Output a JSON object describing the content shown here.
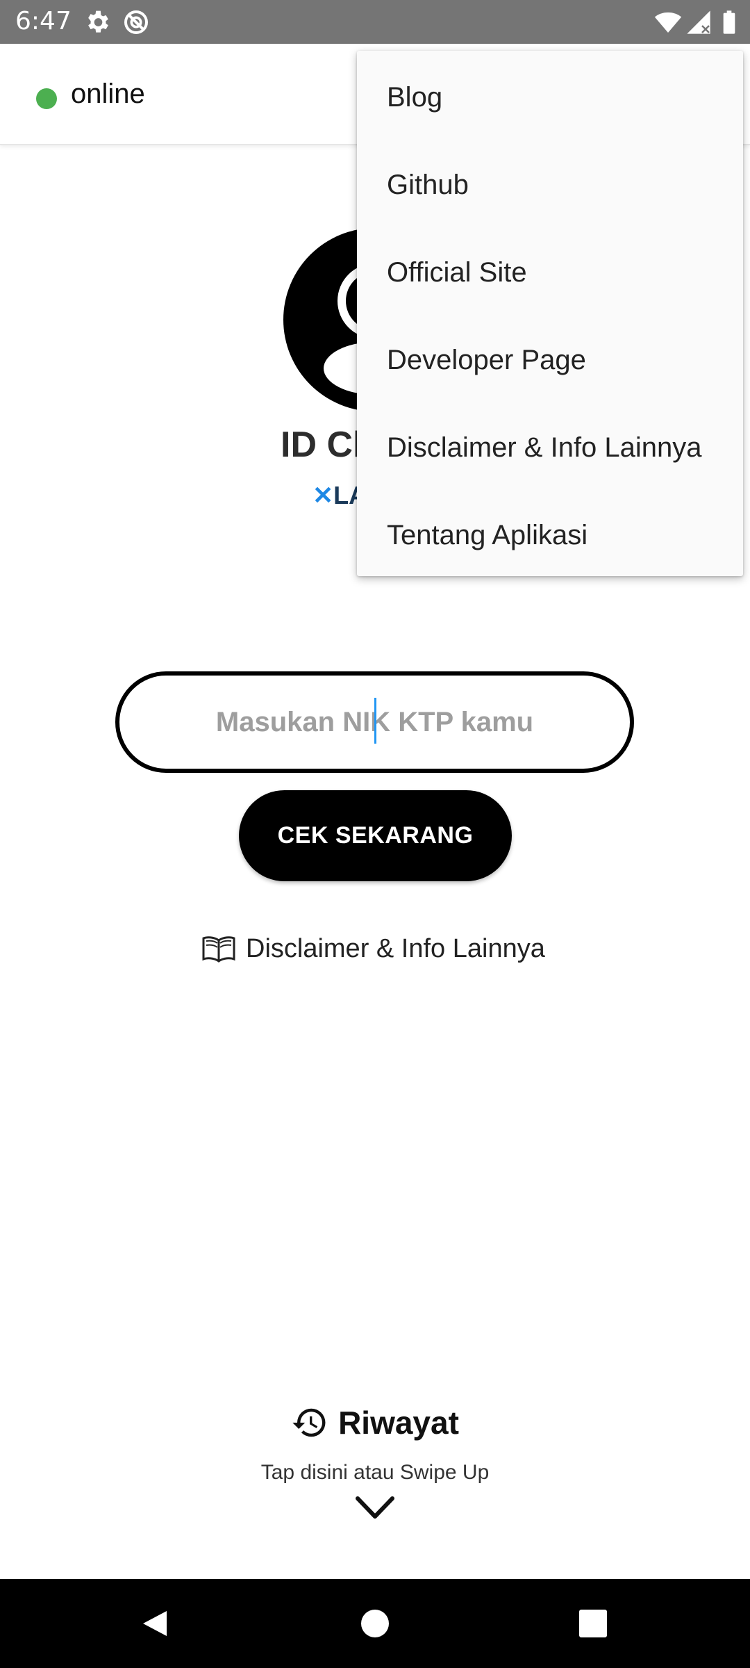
{
  "status_bar": {
    "time": "6:47",
    "icons": [
      "settings-icon",
      "do-not-disturb-icon",
      "wifi-icon",
      "signal-icon",
      "battery-icon"
    ]
  },
  "app_bar": {
    "status_label": "online",
    "status_color": "#4caf50"
  },
  "main": {
    "title_visible": "ID Ch",
    "subtitle_visible": "LA",
    "nik_input": {
      "value": "",
      "placeholder": "Masukan NIK KTP kamu"
    },
    "check_button_label": "CEK SEKARANG",
    "disclaimer_link_label": "Disclaimer & Info Lainnya"
  },
  "history": {
    "title": "Riwayat",
    "hint": "Tap disini atau Swipe Up"
  },
  "overflow_menu": {
    "items": [
      {
        "label": "Blog"
      },
      {
        "label": "Github"
      },
      {
        "label": "Official Site"
      },
      {
        "label": "Developer Page"
      },
      {
        "label": "Disclaimer & Info Lainnya"
      },
      {
        "label": "Tentang Aplikasi"
      }
    ]
  },
  "nav_bar": {
    "buttons": [
      "back-icon",
      "home-icon",
      "recents-icon"
    ]
  },
  "colors": {
    "status_bar_bg": "#757575",
    "accent_blue": "#1e88e5",
    "button_bg": "#000000",
    "menu_bg": "#fafafa"
  }
}
